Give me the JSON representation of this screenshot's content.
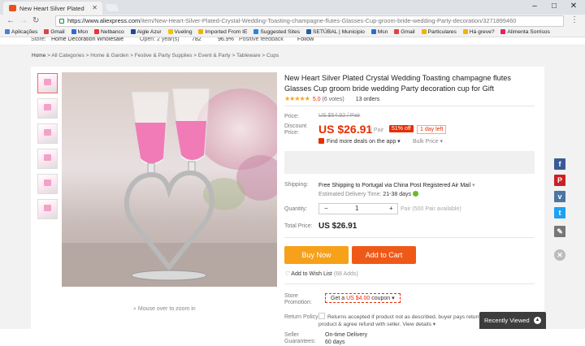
{
  "browser": {
    "tab_title": "New Heart Silver Plated",
    "url_domain": "https://www.aliexpress.com",
    "url_path": "/item/New-Heart-Silver-Plated-Crystal-Wedding-Toasting-champagne-flutes-Glasses-Cup-groom-bride-wedding-Party-decoration/3271899460",
    "bookmarks": [
      "Aplicações",
      "Gmail",
      "Msn",
      "Netbanco",
      "Aigle Azur",
      "Vueling",
      "Imported From IE",
      "Suggested Sites",
      "SETÚBAL | Municipio",
      "Msn",
      "Gmail",
      "Particulares",
      "Há greve?",
      "Alimenta Sorrisos"
    ]
  },
  "store_bar": {
    "store_label": "Store:",
    "store_name": "Home Decoration Wholesale",
    "opened": "Open: 2 year(s)",
    "score": "782",
    "feedback_pct": "96.9%",
    "feedback_label": "Positive feedback",
    "follow": "Follow"
  },
  "breadcrumb": [
    "Home",
    "All Categories",
    "Home & Garden",
    "Festive & Party Supplies",
    "Event & Party",
    "Tableware",
    "Cups"
  ],
  "product": {
    "title": "New Heart Silver Plated Crystal Wedding Toasting champagne flutes Glasses Cup groom bride wedding Party decoration cup for Gift",
    "stars": "★★★★★",
    "rating": "5.0",
    "votes": "(6 votes)",
    "orders": "13 orders",
    "zoom_hint": "Mouse over to zoom in"
  },
  "pricing": {
    "price_label": "Price:",
    "old_price": "US $54.92 / Pair",
    "discount_label": "Discount Price:",
    "discount_price": "US $26.91",
    "unit": "/ Pair",
    "off": "51% off",
    "days_left": "1 day left",
    "deals": "Find more deals on the app",
    "bulk": "Bulk Price"
  },
  "shipping": {
    "label": "Shipping:",
    "text": "Free Shipping to Portugal via China Post Registered Air Mail",
    "eta_label": "Estimated Delivery Time:",
    "eta": "21-38 days"
  },
  "quantity": {
    "label": "Quantity:",
    "value": "1",
    "minus": "−",
    "plus": "+",
    "available": "Pair (500 Pair available)"
  },
  "total": {
    "label": "Total Price:",
    "value": "US $26.91"
  },
  "actions": {
    "buy_now": "Buy Now",
    "add_to_cart": "Add to Cart",
    "wishlist": "Add to Wish List",
    "wishlist_count": "(68 Adds)"
  },
  "promo": {
    "label": "Store Promotion:",
    "coupon_prefix": "Get a ",
    "coupon_value": "US $4.00",
    "coupon_suffix": " coupon"
  },
  "policy": {
    "label": "Return Policy:",
    "text": "Returns accepted if product not as described, buyer pays return shipping fee; or keep the product & agree refund with seller.",
    "link": "View details"
  },
  "guarantee": {
    "label": "Seller Guarantees:",
    "line1": "On-time Delivery",
    "line2": "60 days"
  },
  "sidebar": {
    "recent": "Recently Viewed"
  },
  "colors": {
    "accent": "#e62e04",
    "buy_now": "#f6a119",
    "add_cart": "#ef5918"
  }
}
